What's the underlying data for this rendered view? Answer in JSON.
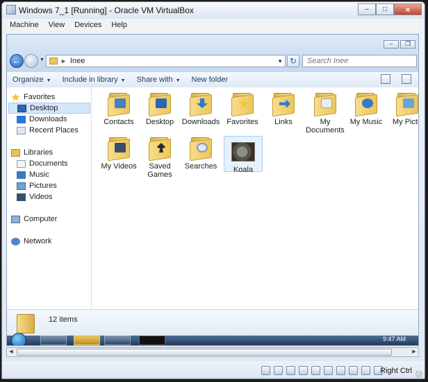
{
  "window": {
    "title": "Windows 7_1 [Running] - Oracle VM VirtualBox"
  },
  "menu": [
    "Machine",
    "View",
    "Devices",
    "Help"
  ],
  "explorer": {
    "breadcrumb": "Inee",
    "search_placeholder": "Search Inee",
    "commands": [
      "Organize",
      "Include in library",
      "Share with",
      "New folder"
    ]
  },
  "nav": {
    "favorites": {
      "label": "Favorites",
      "items": [
        "Desktop",
        "Downloads",
        "Recent Places"
      ]
    },
    "libraries": {
      "label": "Libraries",
      "items": [
        "Documents",
        "Music",
        "Pictures",
        "Videos"
      ]
    },
    "computer": "Computer",
    "network": "Network"
  },
  "items": [
    {
      "label": "Contacts",
      "color": "#4a7fc1"
    },
    {
      "label": "Desktop",
      "color": "#2c64b8"
    },
    {
      "label": "Downloads",
      "color": "#2a78d2"
    },
    {
      "label": "Favorites",
      "color": "#f2c53d"
    },
    {
      "label": "Links",
      "color": "#2a78d2"
    },
    {
      "label": "My Documents",
      "color": "#e8edf3"
    },
    {
      "label": "My Music",
      "color": "#3a78c8"
    },
    {
      "label": "My Pictu",
      "color": "#6aa4d8"
    },
    {
      "label": "My Videos",
      "color": "#3a4f6e"
    },
    {
      "label": "Saved Games",
      "color": "#2a2a2a"
    },
    {
      "label": "Searches",
      "color": "#dfe8f1"
    },
    {
      "label": "Koala",
      "color": "#6b5f53"
    }
  ],
  "details": {
    "count": "12 items"
  },
  "taskbar": {
    "clock": "9:47 AM"
  },
  "statusbar": {
    "hostkey": "Right Ctrl"
  }
}
